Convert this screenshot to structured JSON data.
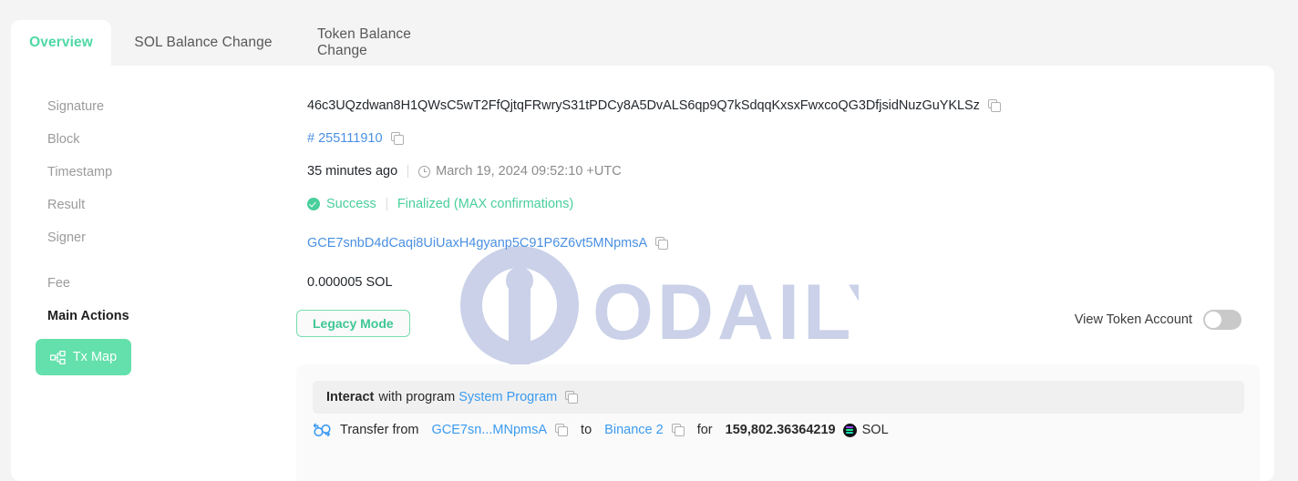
{
  "tabs": [
    {
      "label": "Overview",
      "active": true
    },
    {
      "label": "SOL Balance Change",
      "active": false
    },
    {
      "label": "Token Balance Change",
      "active": false
    }
  ],
  "details": {
    "signature": {
      "label": "Signature",
      "value": "46c3UQzdwan8H1QWsC5wT2FfQjtqFRwryS31tPDCy8A5DvALS6qp9Q7kSdqqKxsxFwxcoQG3DfjsidNuzGuYKLSz"
    },
    "block": {
      "label": "Block",
      "value": "# 255111910"
    },
    "timestamp": {
      "label": "Timestamp",
      "relative": "35 minutes ago",
      "absolute": "March 19, 2024 09:52:10 +UTC"
    },
    "result": {
      "label": "Result",
      "status": "Success",
      "confirmation": "Finalized (MAX confirmations)"
    },
    "signer": {
      "label": "Signer",
      "value": "GCE7snbD4dCaqi8UiUaxH4gyanp5C91P6Z6vt5MNpmsA"
    },
    "fee": {
      "label": "Fee",
      "value": "0.000005 SOL"
    },
    "main_actions": {
      "label": "Main Actions"
    }
  },
  "buttons": {
    "tx_map": "Tx Map",
    "legacy_mode": "Legacy Mode"
  },
  "toggle": {
    "label": "View Token Account",
    "on": false
  },
  "instruction": {
    "interact_bold": "Interact",
    "interact_text": "with program",
    "program_name": "System Program",
    "transfer_prefix": "Transfer from",
    "from_address": "GCE7sn...MNpmsA",
    "to_word": "to",
    "to_address": "Binance 2",
    "for_word": "for",
    "amount": "159,802.36364219",
    "token_symbol": "SOL"
  },
  "watermark": {
    "text": "ODAILY"
  },
  "colors": {
    "accent_green": "#4ed9a4",
    "link_blue": "#4a90e2",
    "success_green": "#49cf9c",
    "card_bg": "#ffffff",
    "page_bg": "#f4f4f4"
  }
}
